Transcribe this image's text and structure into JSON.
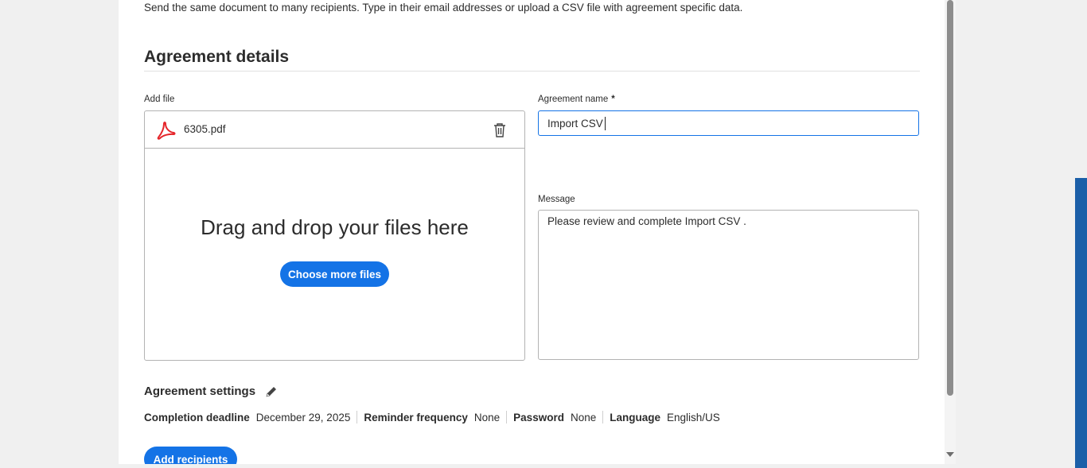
{
  "intro_text": "Send the same document to many recipients. Type in their email addresses or upload a CSV file with agreement specific data.",
  "agreement_details": {
    "title": "Agreement details",
    "add_file_label": "Add file",
    "file_name": "6305.pdf",
    "drop_text": "Drag and drop your files here",
    "choose_button": "Choose more files",
    "agreement_name_label": "Agreement name",
    "required_marker": "*",
    "agreement_name_value": "Import CSV",
    "message_label": "Message",
    "message_value": "Please review and complete Import CSV ."
  },
  "settings": {
    "title": "Agreement settings",
    "completion_deadline_label": "Completion deadline",
    "completion_deadline_value": "December 29, 2025",
    "reminder_label": "Reminder frequency",
    "reminder_value": "None",
    "password_label": "Password",
    "password_value": "None",
    "language_label": "Language",
    "language_value": "English/US"
  },
  "add_recipients_button": "Add recipients",
  "icons": {
    "file": "pdf-icon",
    "delete": "trash-icon",
    "edit": "pencil-icon"
  },
  "colors": {
    "accent": "#1473e6",
    "pdf_red": "#e5252a"
  }
}
